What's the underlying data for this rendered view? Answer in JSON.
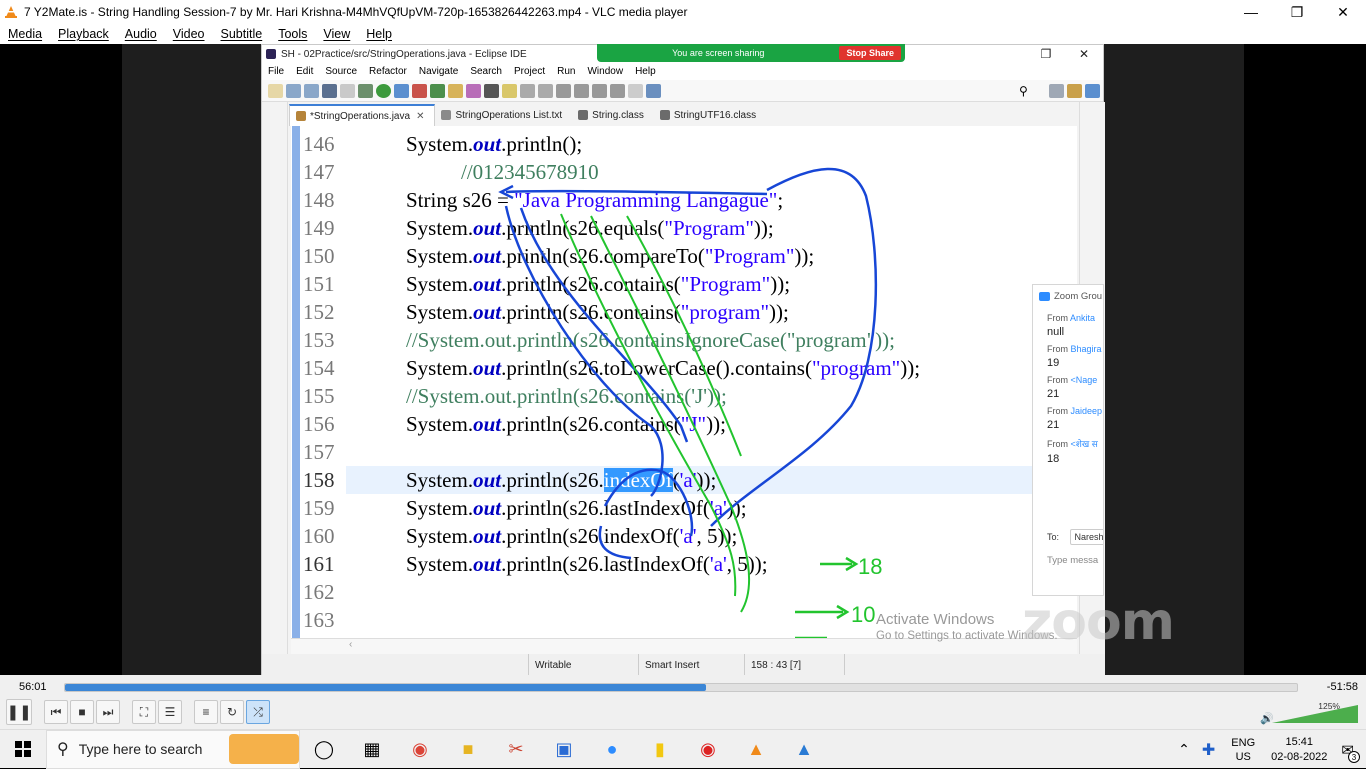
{
  "vlc": {
    "title": "7 Y2Mate.is - String Handling Session-7  by Mr. Hari Krishna-M4MhVQfUpVM-720p-1653826442263.mp4 - VLC media player",
    "menu": [
      "Media",
      "Playback",
      "Audio",
      "Video",
      "Subtitle",
      "Tools",
      "View",
      "Help"
    ],
    "elapsed": "56:01",
    "remaining": "-51:58",
    "progress_fraction": 0.52,
    "volume_label": "125%"
  },
  "eclipse": {
    "title": "SH - 02Practice/src/StringOperations.java - Eclipse IDE",
    "menu": [
      "File",
      "Edit",
      "Source",
      "Refactor",
      "Navigate",
      "Search",
      "Project",
      "Run",
      "Window",
      "Help"
    ],
    "tabs": [
      "*StringOperations.java",
      "StringOperations List.txt",
      "String.class",
      "StringUTF16.class"
    ],
    "lines": [
      {
        "num": "146",
        "code": "System.out.println();"
      },
      {
        "num": "147",
        "code": "//012345678910"
      },
      {
        "num": "148",
        "code": "String s26 = \"Java Programming Langague\";"
      },
      {
        "num": "149",
        "code": "System.out.println(s26.equals(\"Program\"));"
      },
      {
        "num": "150",
        "code": "System.out.println(s26.compareTo(\"Program\"));"
      },
      {
        "num": "151",
        "code": "System.out.println(s26.contains(\"Program\"));"
      },
      {
        "num": "152",
        "code": "System.out.println(s26.contains(\"program\"));"
      },
      {
        "num": "153",
        "code": "//System.out.println(s26.containsIgnoreCase(\"program\"));"
      },
      {
        "num": "154",
        "code": "System.out.println(s26.toLowerCase().contains(\"program\"));"
      },
      {
        "num": "155",
        "code": "//System.out.println(s26.contains('J'));"
      },
      {
        "num": "156",
        "code": "System.out.println(s26.contains(\"J\"));"
      },
      {
        "num": "157",
        "code": ""
      },
      {
        "num": "158",
        "code": "System.out.println(s26.indexOf('a'));"
      },
      {
        "num": "159",
        "code": "System.out.println(s26.lastIndexOf('a'));"
      },
      {
        "num": "160",
        "code": "System.out.println(s26.indexOf('a', 5));"
      },
      {
        "num": "161",
        "code": "System.out.println(s26.lastIndexOf('a', 5));"
      },
      {
        "num": "162",
        "code": ""
      },
      {
        "num": "163",
        "code": ""
      }
    ],
    "annotations": [
      "10",
      "18"
    ],
    "status": {
      "mode": "Writable",
      "insert": "Smart Insert",
      "position": "158 : 43 [7]"
    }
  },
  "zoom": {
    "share_message": "You are screen sharing",
    "stop_share": "Stop Share",
    "chat_title": "Zoom Grou",
    "messages": [
      {
        "from_prefix": "From",
        "from": "Ankita",
        "text": "null"
      },
      {
        "from_prefix": "From",
        "from": "Bhagira",
        "text": "19"
      },
      {
        "from_prefix": "From",
        "from": "<Nage",
        "text": "21"
      },
      {
        "from_prefix": "From",
        "from": "Jaideep",
        "text": "21"
      },
      {
        "from_prefix": "From",
        "from": "<शेख स",
        "text": "18"
      }
    ],
    "to_label": "To:",
    "recipient": "NareshI",
    "type_placeholder": "Type messa",
    "logo": "zoom"
  },
  "watermark": {
    "line1": "Activate Windows",
    "line2": "Go to Settings to activate Windows."
  },
  "taskbar": {
    "search_placeholder": "Type here to search",
    "lang1": "ENG",
    "lang2": "US",
    "time": "15:41",
    "date": "02-08-2022",
    "notif_count": "3"
  }
}
